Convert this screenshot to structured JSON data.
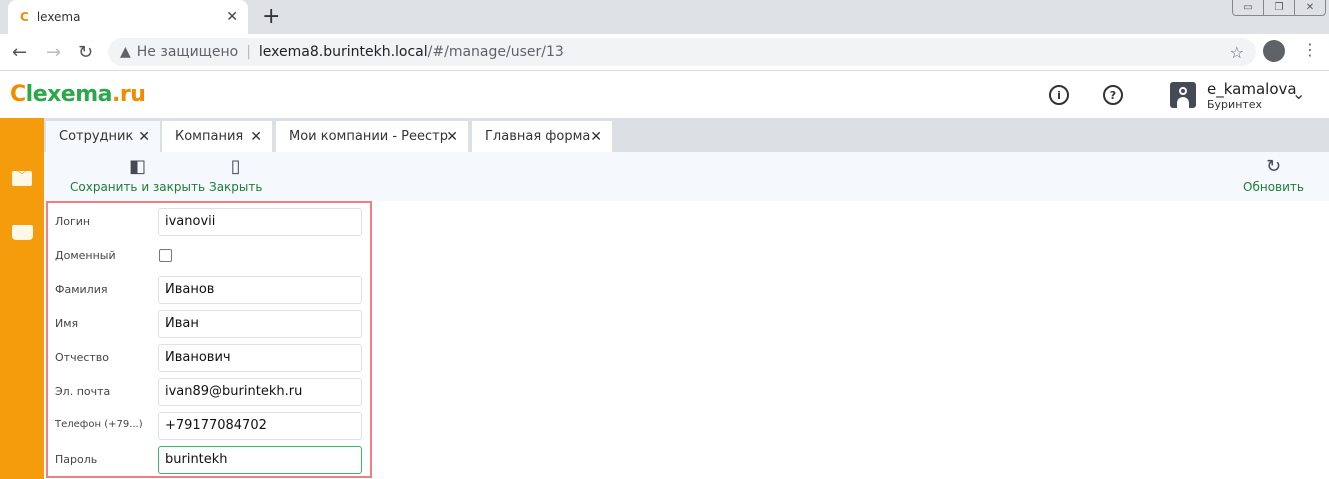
{
  "browser": {
    "tab_title": "lexema",
    "new_tab": "+",
    "address_warning": "Не защищено",
    "url_host": "lexema8.burintekh.local",
    "url_path": "/#/manage/user/13"
  },
  "app": {
    "logo_text_1": "lexema",
    "logo_text_2": ".ru",
    "user": {
      "name": "e_kamalova",
      "org": "Буринтех"
    }
  },
  "tabs": [
    {
      "label": "Сотрудник",
      "active": true
    },
    {
      "label": "Компания"
    },
    {
      "label": "Мои компании - Реестр"
    },
    {
      "label": "Главная форма"
    }
  ],
  "toolbar": {
    "save_close": "Сохранить и закрыть",
    "close": "Закрыть",
    "refresh": "Обновить"
  },
  "form": {
    "login_label": "Логин",
    "login": "ivanovii",
    "domain_label": "Доменный",
    "domain_checked": false,
    "lastname_label": "Фамилия",
    "lastname": "Иванов",
    "firstname_label": "Имя",
    "firstname": "Иван",
    "middlename_label": "Отчество",
    "middlename": "Иванович",
    "email_label": "Эл. почта",
    "email": "ivan89@burintekh.ru",
    "phone_label": "Телефон (+79...)",
    "phone": "+79177084702",
    "password_label": "Пароль",
    "password": "burintekh"
  },
  "colors": {
    "sidebar": "#f59c0c",
    "accent": "#1e7e34",
    "highlight": "#f08080"
  }
}
